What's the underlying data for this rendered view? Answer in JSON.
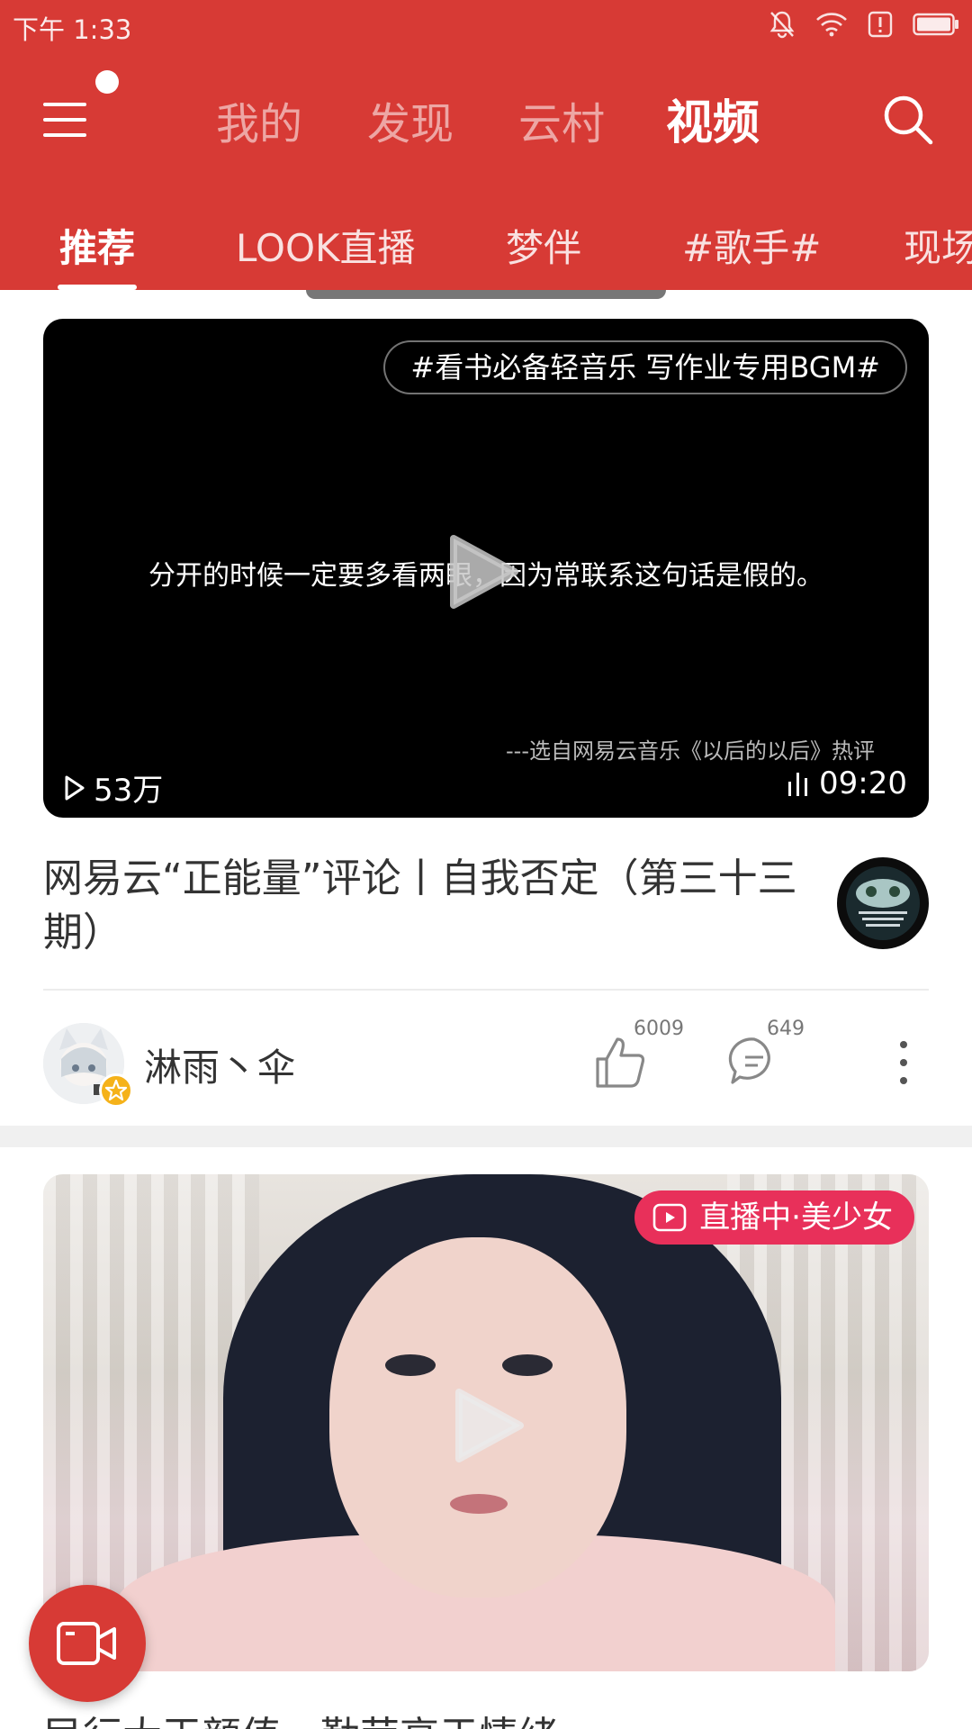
{
  "status_bar": {
    "time": "下午 1:33",
    "icons": [
      "bell-off-icon",
      "wifi-icon",
      "alert-icon",
      "battery-icon"
    ]
  },
  "top_nav": {
    "tabs": [
      {
        "label": "我的"
      },
      {
        "label": "发现"
      },
      {
        "label": "云村"
      },
      {
        "label": "视频",
        "active": true
      }
    ],
    "icons": [
      "menu-icon",
      "search-icon"
    ]
  },
  "sub_tabs": [
    {
      "label": "推荐",
      "active": true
    },
    {
      "label": "LOOK直播"
    },
    {
      "label": "梦伴"
    },
    {
      "label": "#歌手#"
    },
    {
      "label": "现场"
    }
  ],
  "feed": {
    "video1": {
      "tag": "#看书必备轻音乐 写作业专用BGM#",
      "caption": "分开的时候一定要多看两眼，因为常联系这句话是假的。",
      "source": "---选自网易云音乐《以后的以后》热评",
      "play_count": "53万",
      "duration": "09:20",
      "title": "网易云“正能量”评论丨自我否定（第三十三期）",
      "author": "淋雨丶伞",
      "likes": "6009",
      "comments": "649"
    },
    "video2": {
      "live_badge": "直播中·美少女",
      "title": "民行大王颜值，勤劳高于情绪。"
    }
  },
  "colors": {
    "brand_red": "#d73a35",
    "live_pink": "#e8305a"
  }
}
